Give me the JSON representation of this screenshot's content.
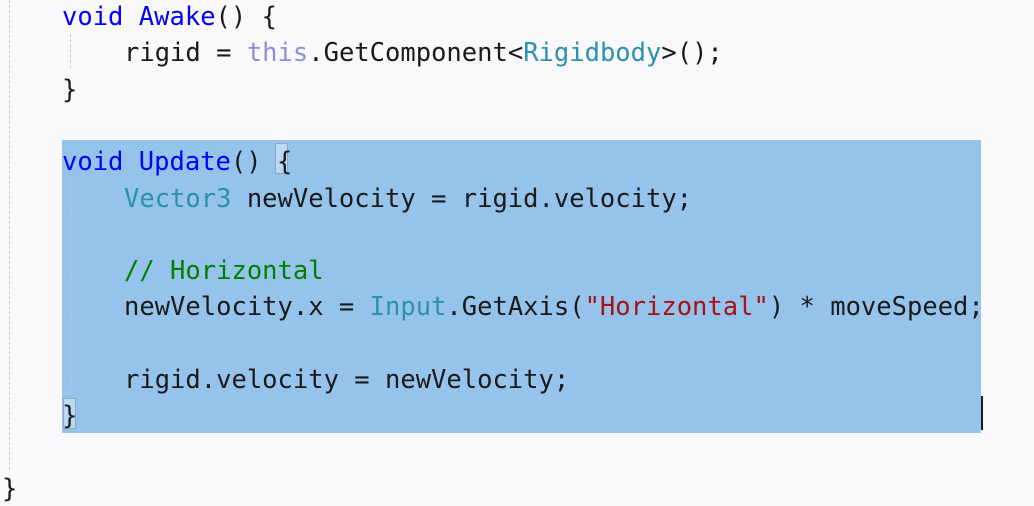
{
  "editor": {
    "colors": {
      "background": "#f9f9fb",
      "selection": "#95c3eb",
      "keyword": "#0000ff",
      "this_keyword": "#8f8fd9",
      "type": "#2b91af",
      "comment": "#008000",
      "string": "#a31515",
      "text": "#1a1a1a"
    },
    "lines": [
      {
        "indent": 1,
        "tokens": [
          {
            "text": "void",
            "kind": "kw"
          },
          {
            "text": " ",
            "kind": "pl"
          },
          {
            "text": "Awake",
            "kind": "fn"
          },
          {
            "text": "() {",
            "kind": "pl"
          }
        ]
      },
      {
        "indent": 2,
        "tokens": [
          {
            "text": "rigid = ",
            "kind": "pl"
          },
          {
            "text": "this",
            "kind": "th"
          },
          {
            "text": ".GetComponent<",
            "kind": "pl"
          },
          {
            "text": "Rigidbody",
            "kind": "ty"
          },
          {
            "text": ">();",
            "kind": "pl"
          }
        ]
      },
      {
        "indent": 1,
        "tokens": [
          {
            "text": "}",
            "kind": "pl"
          }
        ]
      },
      {
        "indent": 0,
        "tokens": []
      },
      {
        "indent": 1,
        "tokens": [
          {
            "text": "void",
            "kind": "kw"
          },
          {
            "text": " ",
            "kind": "pl"
          },
          {
            "text": "Update",
            "kind": "fn"
          },
          {
            "text": "() ",
            "kind": "pl"
          },
          {
            "text": "{",
            "kind": "pl"
          }
        ]
      },
      {
        "indent": 2,
        "tokens": [
          {
            "text": "Vector3",
            "kind": "ty"
          },
          {
            "text": " newVelocity = rigid.velocity;",
            "kind": "pl"
          }
        ]
      },
      {
        "indent": 0,
        "tokens": []
      },
      {
        "indent": 2,
        "tokens": [
          {
            "text": "// Horizontal",
            "kind": "cm"
          }
        ]
      },
      {
        "indent": 2,
        "tokens": [
          {
            "text": "newVelocity.x = ",
            "kind": "pl"
          },
          {
            "text": "Input",
            "kind": "ty"
          },
          {
            "text": ".GetAxis(",
            "kind": "pl"
          },
          {
            "text": "\"Horizontal\"",
            "kind": "st"
          },
          {
            "text": ") * moveSpeed;",
            "kind": "pl"
          }
        ]
      },
      {
        "indent": 0,
        "tokens": []
      },
      {
        "indent": 2,
        "tokens": [
          {
            "text": "rigid.velocity = newVelocity;",
            "kind": "pl"
          }
        ]
      },
      {
        "indent": 1,
        "tokens": [
          {
            "text": "}",
            "kind": "pl"
          }
        ]
      },
      {
        "indent": 0,
        "tokens": []
      },
      {
        "indent": 0,
        "tokens": [
          {
            "text": "}",
            "kind": "pl"
          }
        ]
      }
    ]
  }
}
